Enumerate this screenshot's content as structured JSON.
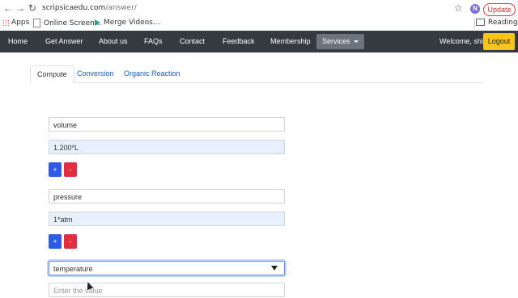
{
  "browser": {
    "url_host": "scripsicaedu.com",
    "url_path": "/answer/",
    "profile_initial": "N",
    "update_label": "Update",
    "bookmarks": [
      "Apps",
      "Online Screen...",
      "Merge Videos...",
      "Reading list"
    ]
  },
  "nav": {
    "items": [
      "Home",
      "Get Answer",
      "About us",
      "FAQs",
      "Contact",
      "Feedback",
      "Membership",
      "Services"
    ],
    "welcome": "Welcome, shiv",
    "logout": "Logout"
  },
  "tabs": [
    "Compute",
    "Conversion",
    "Organic Reaction"
  ],
  "form": {
    "var1_name": "volume",
    "var1_value": "1.200*L",
    "var2_name": "pressure",
    "var2_value": "1*atm",
    "select_value": "temperature",
    "value_placeholder": "Enter the value",
    "plus_label": "+",
    "minus_label": "-"
  },
  "colors": {
    "navbar": "#343a40",
    "logout": "#f5c518",
    "plus": "#2d5be3",
    "minus": "#e03040",
    "link": "#1a5fc4"
  }
}
